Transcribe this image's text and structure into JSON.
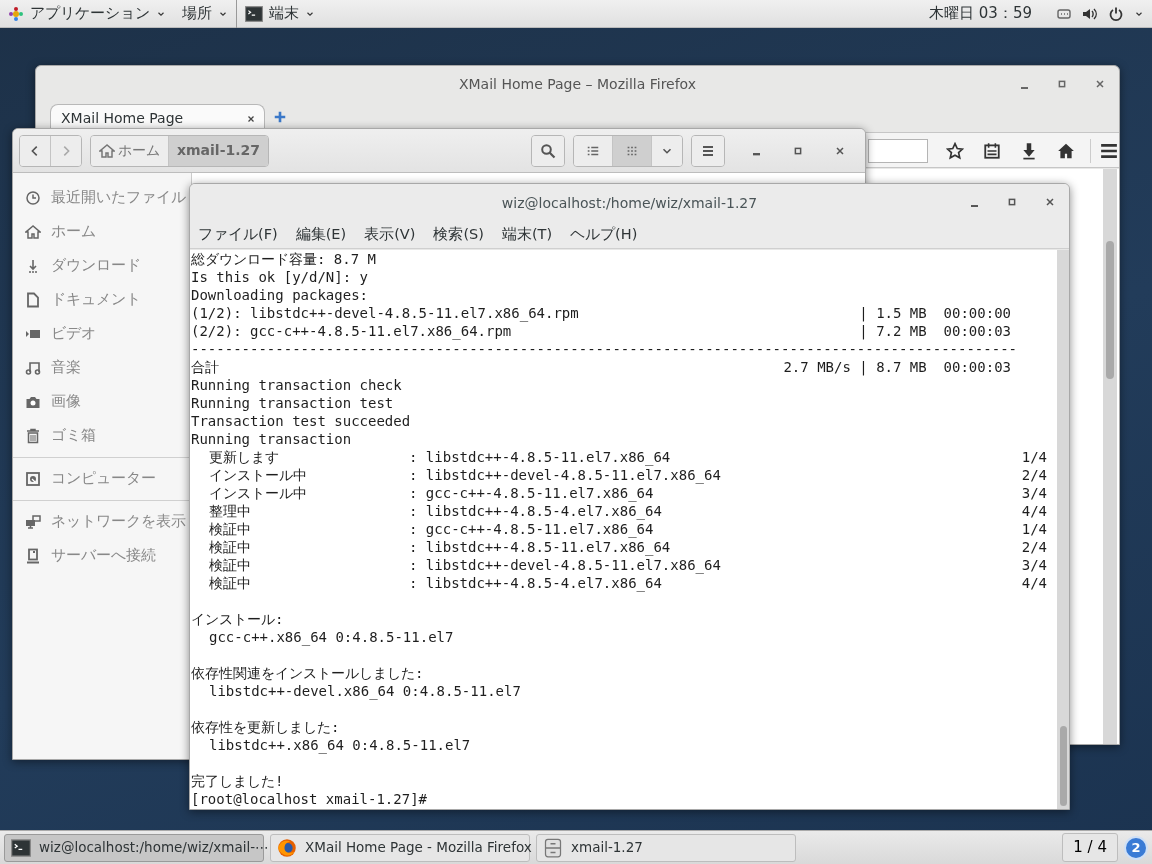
{
  "top_bar": {
    "applications_menu": "アプリケーション",
    "places_menu": "場所",
    "app_menu": "端末",
    "clock": "木曜日 03：59"
  },
  "firefox": {
    "title": "XMail Home Page – Mozilla Firefox",
    "tabs": [
      {
        "label": "XMail Home Page",
        "selected": true
      }
    ]
  },
  "files": {
    "path": [
      {
        "label": "ホーム",
        "selected": false
      },
      {
        "label": "xmail-1.27",
        "selected": true
      }
    ],
    "view_buttons": [
      {
        "kind": "list",
        "selected": false
      },
      {
        "kind": "grid",
        "selected": true
      }
    ],
    "sidebar": [
      [
        {
          "kind": "recent",
          "label": "最近開いたファイル"
        },
        {
          "kind": "home",
          "label": "ホーム"
        },
        {
          "kind": "download",
          "label": "ダウンロード"
        },
        {
          "kind": "document",
          "label": "ドキュメント"
        },
        {
          "kind": "video",
          "label": "ビデオ"
        },
        {
          "kind": "music",
          "label": "音楽"
        },
        {
          "kind": "picture",
          "label": "画像"
        },
        {
          "kind": "trash",
          "label": "ゴミ箱"
        }
      ],
      [
        {
          "kind": "computer",
          "label": "コンピューター"
        }
      ],
      [
        {
          "kind": "network",
          "label": "ネットワークを表示"
        },
        {
          "kind": "server",
          "label": "サーバーへ接続"
        }
      ]
    ]
  },
  "terminal": {
    "title": "wiz@localhost:/home/wiz/xmail-1.27",
    "menu": [
      "ファイル(F)",
      "編集(E)",
      "表示(V)",
      "検索(S)",
      "端末(T)",
      "ヘルプ(H)"
    ],
    "lines": [
      {
        "kind": "text",
        "text": "総ダウンロード容量: 8.7 M"
      },
      {
        "kind": "text",
        "text": "Is this ok [y/d/N]: y"
      },
      {
        "kind": "text",
        "text": "Downloading packages:"
      },
      {
        "kind": "download",
        "text": "(1/2): libstdc++-devel-4.8.5-11.el7.x86_64.rpm",
        "stats": "| 1.5 MB  00:00:00"
      },
      {
        "kind": "download",
        "text": "(2/2): gcc-c++-4.8.5-11.el7.x86_64.rpm",
        "stats": "| 7.2 MB  00:00:03"
      },
      {
        "kind": "rule",
        "text": "--------------------------------------------------------------------------------------------------"
      },
      {
        "kind": "download",
        "text": "合計",
        "stats": "2.7 MB/s | 8.7 MB  00:00:03"
      },
      {
        "kind": "text",
        "text": "Running transaction check"
      },
      {
        "kind": "text",
        "text": "Running transaction test"
      },
      {
        "kind": "text",
        "text": "Transaction test succeeded"
      },
      {
        "kind": "text",
        "text": "Running transaction"
      },
      {
        "kind": "step",
        "text": "更新します",
        "package": ": libstdc++-4.8.5-11.el7.x86_64",
        "count": "1/4"
      },
      {
        "kind": "step",
        "text": "インストール中",
        "package": ": libstdc++-devel-4.8.5-11.el7.x86_64",
        "count": "2/4"
      },
      {
        "kind": "step",
        "text": "インストール中",
        "package": ": gcc-c++-4.8.5-11.el7.x86_64",
        "count": "3/4"
      },
      {
        "kind": "step",
        "text": "整理中",
        "package": ": libstdc++-4.8.5-4.el7.x86_64",
        "count": "4/4"
      },
      {
        "kind": "step",
        "text": "検証中",
        "package": ": gcc-c++-4.8.5-11.el7.x86_64",
        "count": "1/4"
      },
      {
        "kind": "step",
        "text": "検証中",
        "package": ": libstdc++-4.8.5-11.el7.x86_64",
        "count": "2/4"
      },
      {
        "kind": "step",
        "text": "検証中",
        "package": ": libstdc++-devel-4.8.5-11.el7.x86_64",
        "count": "3/4"
      },
      {
        "kind": "step",
        "text": "検証中",
        "package": ": libstdc++-4.8.5-4.el7.x86_64",
        "count": "4/4"
      },
      {
        "kind": "blank"
      },
      {
        "kind": "text",
        "text": "インストール:"
      },
      {
        "kind": "indent",
        "text": "gcc-c++.x86_64 0:4.8.5-11.el7"
      },
      {
        "kind": "blank"
      },
      {
        "kind": "text",
        "text": "依存性関連をインストールしました:"
      },
      {
        "kind": "indent",
        "text": "libstdc++-devel.x86_64 0:4.8.5-11.el7"
      },
      {
        "kind": "blank"
      },
      {
        "kind": "text",
        "text": "依存性を更新しました:"
      },
      {
        "kind": "indent",
        "text": "libstdc++.x86_64 0:4.8.5-11.el7"
      },
      {
        "kind": "blank"
      },
      {
        "kind": "text",
        "text": "完了しました!"
      },
      {
        "kind": "prompt",
        "text": "[root@localhost xmail-1.27]#"
      }
    ]
  },
  "taskbar": {
    "items": [
      {
        "kind": "terminal",
        "label": "wiz@localhost:/home/wiz/xmail-⋯",
        "selected": true
      },
      {
        "kind": "browser",
        "label": "XMail Home Page - Mozilla Firefox",
        "selected": false
      },
      {
        "kind": "files",
        "label": "xmail-1.27",
        "selected": false
      }
    ],
    "workspace": "1 / 4",
    "notifications": "2"
  }
}
